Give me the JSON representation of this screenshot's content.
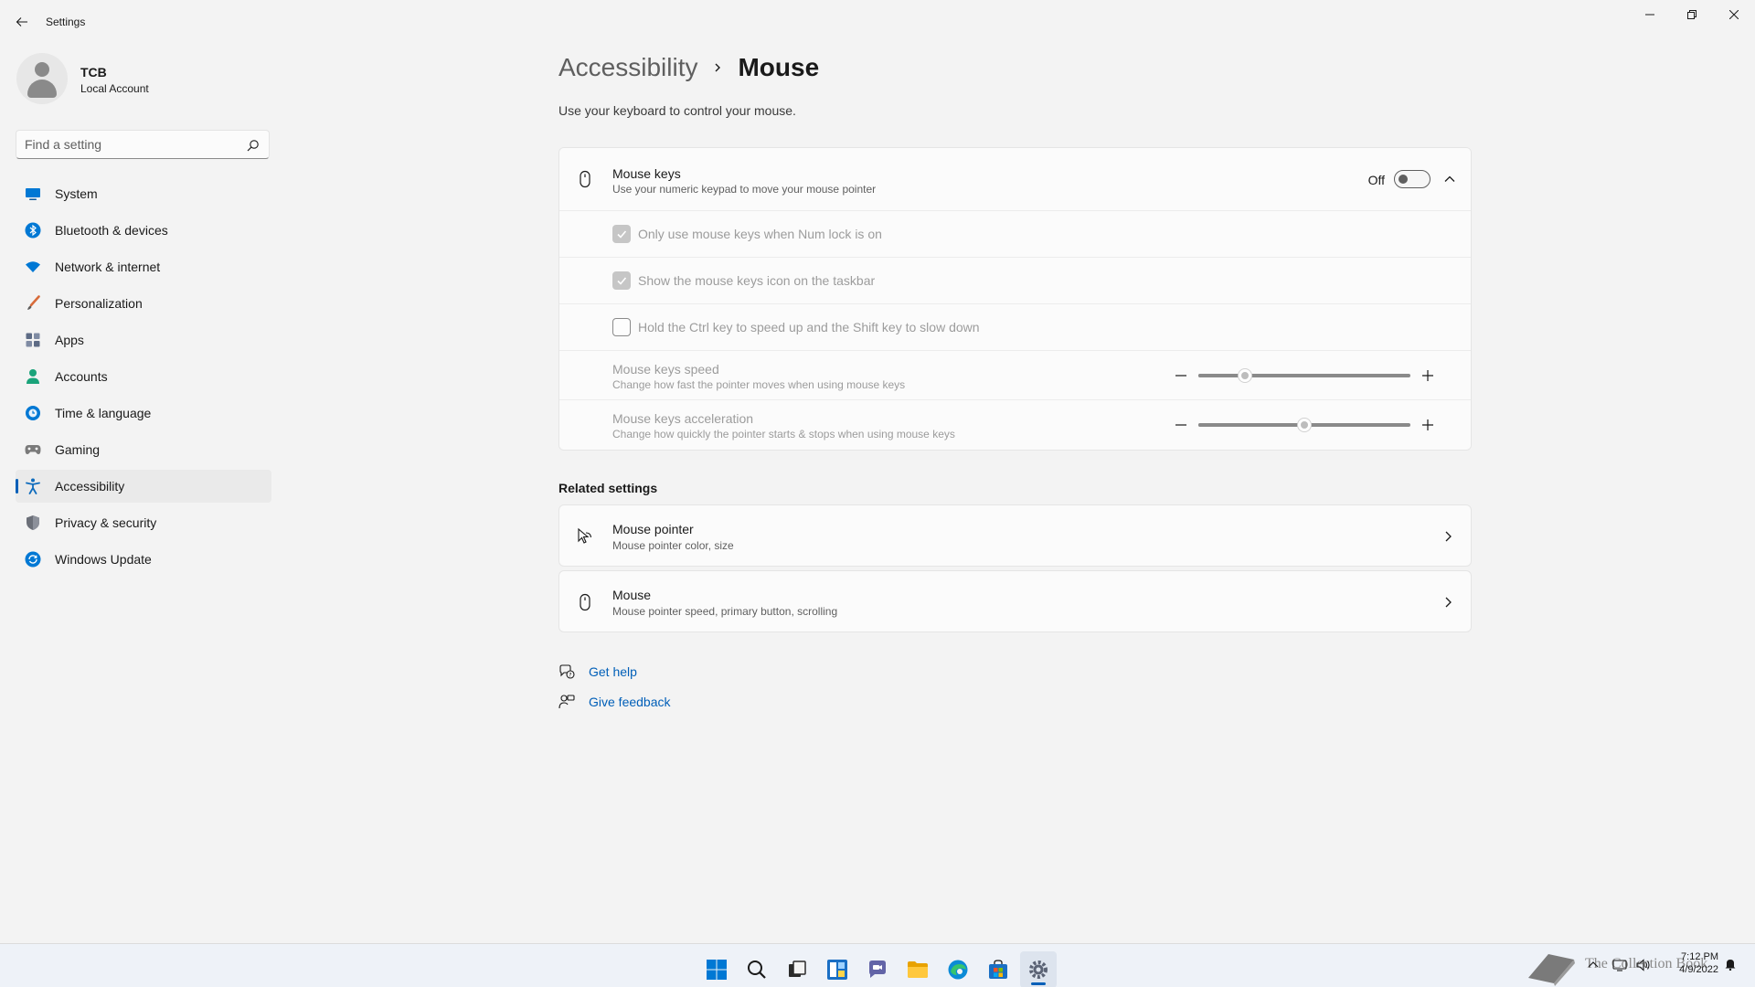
{
  "window": {
    "app_title": "Settings"
  },
  "profile": {
    "name": "TCB",
    "account_type": "Local Account"
  },
  "search": {
    "placeholder": "Find a setting"
  },
  "sidebar": {
    "items": [
      {
        "label": "System",
        "icon": "monitor-icon",
        "color": "#0078d4"
      },
      {
        "label": "Bluetooth & devices",
        "icon": "bluetooth-icon",
        "color": "#0078d4"
      },
      {
        "label": "Network & internet",
        "icon": "wifi-icon",
        "color": "#0078d4"
      },
      {
        "label": "Personalization",
        "icon": "brush-icon",
        "color": "#d86b3a"
      },
      {
        "label": "Apps",
        "icon": "apps-icon",
        "color": "#5d6b85"
      },
      {
        "label": "Accounts",
        "icon": "person-icon",
        "color": "#1aa37a"
      },
      {
        "label": "Time & language",
        "icon": "globe-clock-icon",
        "color": "#0078d4"
      },
      {
        "label": "Gaming",
        "icon": "gamepad-icon",
        "color": "#7a7a7a"
      },
      {
        "label": "Accessibility",
        "icon": "accessibility-icon",
        "color": "#0f6cbd",
        "active": true
      },
      {
        "label": "Privacy & security",
        "icon": "shield-icon",
        "color": "#6b6f78"
      },
      {
        "label": "Windows Update",
        "icon": "update-icon",
        "color": "#0078d4"
      }
    ]
  },
  "main": {
    "breadcrumb_parent": "Accessibility",
    "breadcrumb_current": "Mouse",
    "description": "Use your keyboard to control your mouse.",
    "mouse_keys": {
      "title": "Mouse keys",
      "subtitle": "Use your numeric keypad to move your mouse pointer",
      "toggle_state": "Off",
      "toggle_on": false,
      "expanded": true
    },
    "options": [
      {
        "label": "Only use mouse keys when Num lock is on",
        "checked": true
      },
      {
        "label": "Show the mouse keys icon on the taskbar",
        "checked": true
      },
      {
        "label": "Hold the Ctrl key to speed up and the Shift key to slow down",
        "checked": false
      }
    ],
    "sliders": [
      {
        "title": "Mouse keys speed",
        "subtitle": "Change how fast the pointer moves when using mouse keys",
        "value_fraction": 0.22
      },
      {
        "title": "Mouse keys acceleration",
        "subtitle": "Change how quickly the pointer starts & stops when using mouse keys",
        "value_fraction": 0.5
      }
    ],
    "related_heading": "Related settings",
    "related": [
      {
        "title": "Mouse pointer",
        "subtitle": "Mouse pointer color, size",
        "icon": "mouse-pointer-icon"
      },
      {
        "title": "Mouse",
        "subtitle": "Mouse pointer speed, primary button, scrolling",
        "icon": "mouse-icon"
      }
    ],
    "help_links": [
      {
        "label": "Get help",
        "icon": "help-icon"
      },
      {
        "label": "Give feedback",
        "icon": "feedback-icon"
      }
    ]
  },
  "taskbar": {
    "apps": [
      "start-icon",
      "search-icon",
      "task-view-icon",
      "widgets-icon",
      "chat-icon",
      "file-explorer-icon",
      "edge-icon",
      "store-icon",
      "settings-icon"
    ],
    "active_app": "settings-icon",
    "watermark_text": "The Collection Book",
    "time": "7:12 PM",
    "date": "4/9/2022"
  },
  "colors": {
    "accent": "#005fb8",
    "background": "#f3f3f3",
    "card": "#fbfbfb"
  }
}
